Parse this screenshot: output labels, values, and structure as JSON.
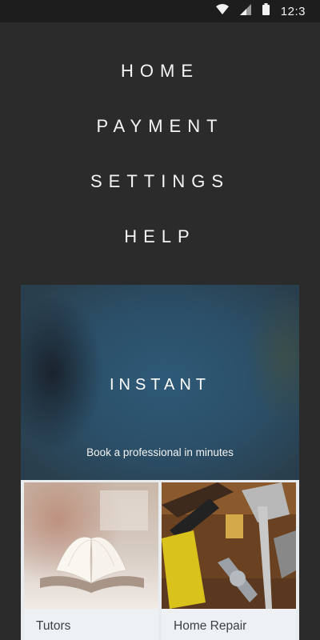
{
  "status_bar": {
    "time": "12:3",
    "icons": [
      "wifi-icon",
      "signal-icon",
      "battery-icon"
    ]
  },
  "menu": {
    "items": [
      {
        "label": "HOME"
      },
      {
        "label": "PAYMENT"
      },
      {
        "label": "SETTINGS"
      },
      {
        "label": "HELP"
      }
    ]
  },
  "hero": {
    "title": "INSTANT",
    "subtitle": "Book a professional in minutes"
  },
  "services": [
    {
      "label": "Tutors",
      "sub": ""
    },
    {
      "label": "Home Repair",
      "sub": ""
    }
  ],
  "colors": {
    "background": "#2b2b2b",
    "status_bar": "#1d1d1d",
    "tile": "#eef1f3"
  }
}
